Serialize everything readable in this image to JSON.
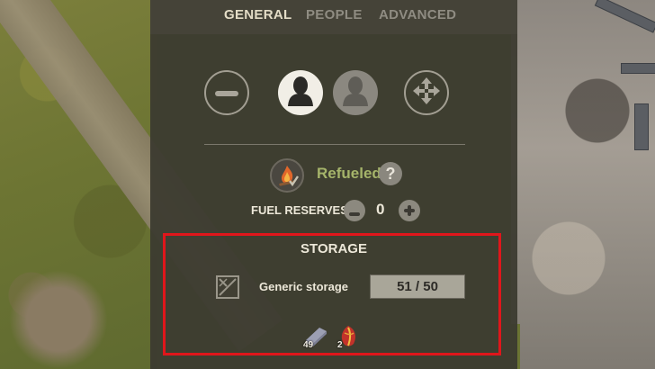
{
  "tabs": [
    {
      "label": "GENERAL",
      "active": true
    },
    {
      "label": "PEOPLE",
      "active": false
    },
    {
      "label": "ADVANCED",
      "active": false
    }
  ],
  "controls": {
    "remove_icon": "minus-icon",
    "worker_assigned_icon": "person-icon",
    "worker_empty_icon": "person-icon",
    "move_icon": "move-arrows-icon"
  },
  "status": {
    "icon": "campfire-icon",
    "text": "Refueled",
    "help": "?"
  },
  "fuel_reserves": {
    "label": "FUEL RESERVES",
    "value": "0",
    "decrease_icon": "minus-icon",
    "increase_icon": "plus-icon"
  },
  "storage": {
    "title": "STORAGE",
    "type_icon": "crate-icon",
    "name": "Generic storage",
    "capacity": "51 / 50",
    "items": [
      {
        "icon": "iron-bar-icon",
        "count": "49"
      },
      {
        "icon": "red-leaf-icon",
        "count": "2"
      }
    ]
  },
  "colors": {
    "active_tab": "#e3dcc6",
    "inactive_tab": "#8f8c82",
    "status_green": "#a5b46a",
    "highlight_red": "#e0161b"
  }
}
